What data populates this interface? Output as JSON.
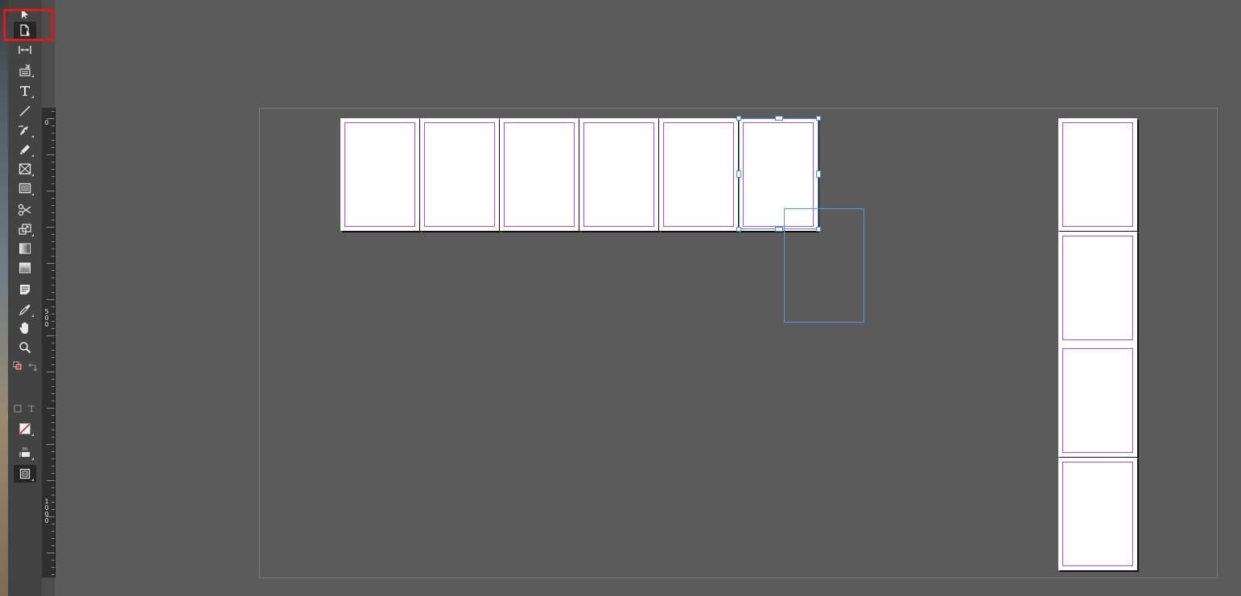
{
  "toolbar": {
    "tools": [
      {
        "name": "selection-tool",
        "icon": "arrow-icon",
        "active": false
      },
      {
        "name": "page-tool",
        "icon": "page-tool-icon",
        "active": true
      },
      {
        "name": "gap-tool",
        "icon": "gap-icon",
        "active": false
      },
      {
        "name": "content-collector-tool",
        "icon": "content-collector-icon",
        "active": false
      },
      {
        "name": "type-tool",
        "icon": "type-icon",
        "active": false
      },
      {
        "name": "line-tool",
        "icon": "line-icon",
        "active": false
      },
      {
        "name": "pen-tool",
        "icon": "pen-icon",
        "active": false
      },
      {
        "name": "pencil-tool",
        "icon": "pencil-icon",
        "active": false
      },
      {
        "name": "rectangle-frame-tool",
        "icon": "rectangle-frame-icon",
        "active": false
      },
      {
        "name": "rectangle-tool",
        "icon": "rectangle-icon",
        "active": false
      },
      {
        "name": "scissors-tool",
        "icon": "scissors-icon",
        "active": false
      },
      {
        "name": "free-transform-tool",
        "icon": "free-transform-icon",
        "active": false
      },
      {
        "name": "gradient-swatch-tool",
        "icon": "gradient-swatch-icon",
        "active": false
      },
      {
        "name": "gradient-feather-tool",
        "icon": "gradient-feather-icon",
        "active": false
      },
      {
        "name": "note-tool",
        "icon": "note-icon",
        "active": false
      },
      {
        "name": "eyedropper-tool",
        "icon": "eyedropper-icon",
        "active": false
      },
      {
        "name": "hand-tool",
        "icon": "hand-icon",
        "active": false
      },
      {
        "name": "zoom-tool",
        "icon": "zoom-icon",
        "active": false
      }
    ],
    "formatting_text_glyph": "T"
  },
  "ruler": {
    "labels": [
      "0",
      "5\n0\n0",
      "1\n0\n0\n0"
    ]
  },
  "spread_horizontal": {
    "page_count": 6,
    "selected_page_index": 5
  },
  "spread_vertical": {
    "page_count": 4
  },
  "colors": {
    "app_background": "#5b5b5b",
    "toolbar_background": "#434343",
    "margin_guide": "#b14fd0",
    "selection": "#4a8fd8",
    "highlight": "#e0191f"
  }
}
